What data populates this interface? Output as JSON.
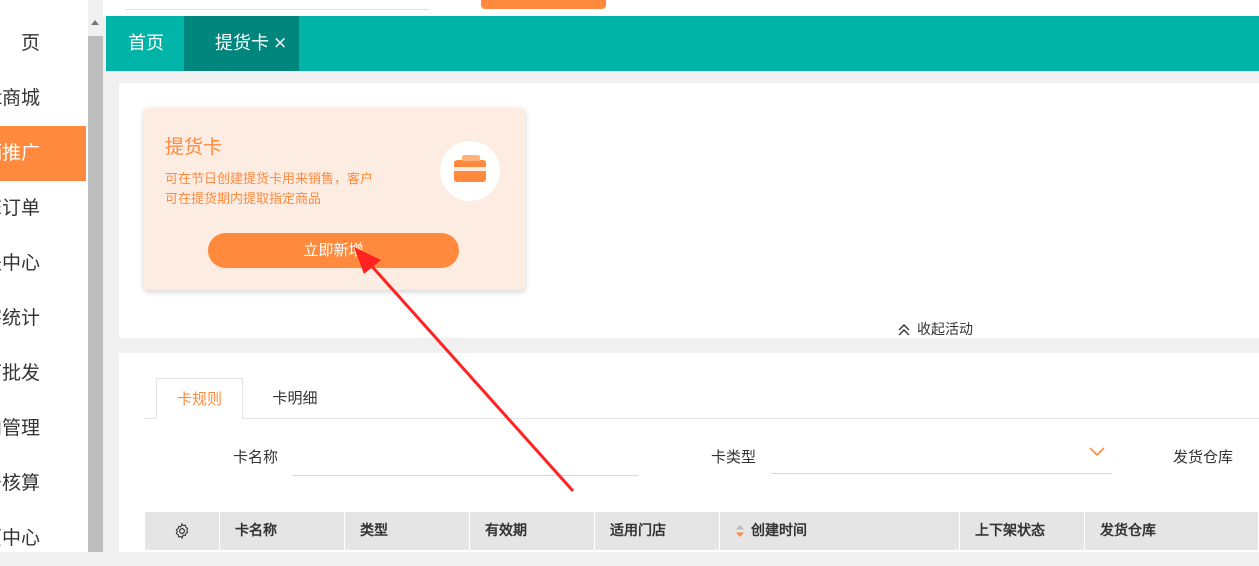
{
  "sidebar": {
    "items": [
      {
        "label": "页"
      },
      {
        "label": "t商城"
      },
      {
        "label": "销推广",
        "active": true
      },
      {
        "label": "E订单"
      },
      {
        "label": "是中心"
      },
      {
        "label": "害统计"
      },
      {
        "label": "下批发"
      },
      {
        "label": "向管理"
      },
      {
        "label": "号核算"
      },
      {
        "label": "页中心"
      }
    ]
  },
  "tabs": {
    "home": "首页",
    "active": "提货卡",
    "close_icon": "×"
  },
  "card": {
    "title": "提货卡",
    "desc_line1": "可在节日创建提货卡用来销售，客户",
    "desc_line2": "可在提货期内提取指定商品",
    "button": "立即新增",
    "icon": "card-icon"
  },
  "collapse": {
    "label": "收起活动"
  },
  "subtabs": [
    "卡规则",
    "卡明细"
  ],
  "filters": {
    "card_name": "卡名称",
    "card_type": "卡类型",
    "warehouse": "发货仓库"
  },
  "table": {
    "columns": [
      "卡名称",
      "类型",
      "有效期",
      "适用门店",
      "创建时间",
      "上下架状态",
      "发货仓库"
    ]
  },
  "colors": {
    "accent": "#ff8a3d",
    "teal": "#00b5a7",
    "teal_dark": "#00867d",
    "card_bg": "#fdece2",
    "annotation": "#f22"
  }
}
